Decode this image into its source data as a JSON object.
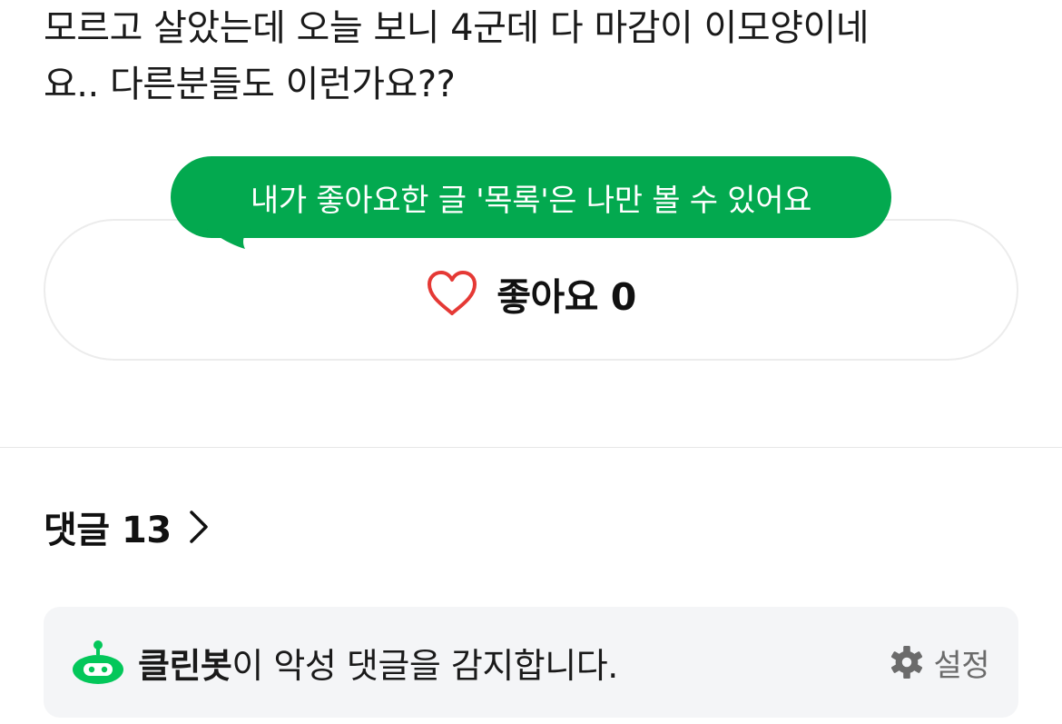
{
  "post": {
    "body_lines": [
      "모르고 살았는데 오늘 보니 4군데 다 마감이 이모양이네",
      "요..  다른분들도 이런가요??"
    ]
  },
  "like": {
    "tooltip": "내가 좋아요한 글 '목록'은 나만 볼 수 있어요",
    "label": "좋아요",
    "count": "0",
    "icon": "heart-outline-icon",
    "heart_color": "#e53935",
    "tooltip_color": "#03a94f"
  },
  "comments": {
    "label": "댓글",
    "count": "13",
    "icon": "chevron-right-icon"
  },
  "cleanbot": {
    "name": "클린봇",
    "message": "이 악성 댓글을 감지합니다.",
    "settings_label": "설정",
    "bot_icon": "cleanbot-icon",
    "settings_icon": "gear-icon",
    "bot_color": "#03c75a"
  }
}
